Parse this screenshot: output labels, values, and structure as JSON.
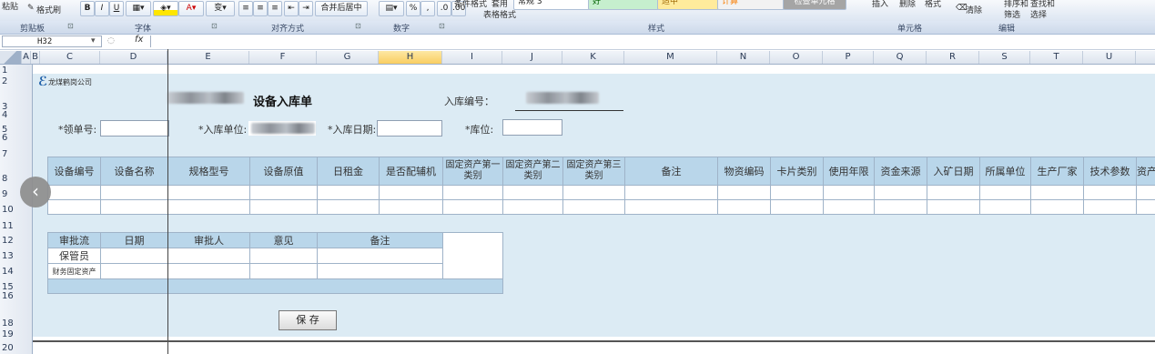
{
  "ribbon": {
    "paste": "粘贴",
    "format_painter": "格式刷",
    "bold": "B",
    "italic": "I",
    "underline": "U",
    "wrap_merge": "合并后居中",
    "percent": "%",
    "comma": ",",
    "cond_format": "条件格式",
    "table_format_1": "套用",
    "table_format_2": "表格格式",
    "style_normal": "常规 3",
    "style_good": "好",
    "style_neutral": "适中",
    "style_calc": "计算",
    "style_check": "检查单元格",
    "insert": "插入",
    "delete": "删除",
    "format": "格式",
    "clear": "清除",
    "sort_filter_1": "排序和",
    "sort_filter_2": "筛选",
    "find_select_1": "查找和",
    "find_select_2": "选择"
  },
  "groups": {
    "clipboard": "剪贴板",
    "font": "字体",
    "alignment": "对齐方式",
    "number": "数字",
    "styles": "样式",
    "cells": "单元格",
    "editing": "编辑"
  },
  "formula_bar": {
    "name_box": "H32",
    "fx": "fx",
    "value": ""
  },
  "columns": [
    "A",
    "B",
    "C",
    "D",
    "E",
    "F",
    "G",
    "H",
    "I",
    "J",
    "K",
    "M",
    "N",
    "O",
    "P",
    "Q",
    "R",
    "S",
    "T",
    "U"
  ],
  "selected_column": "H",
  "rows": [
    "1",
    "2",
    "3",
    "4",
    "5",
    "6",
    "7",
    "8",
    "9",
    "10",
    "11",
    "12",
    "13",
    "14",
    "15",
    "16",
    "18",
    "19",
    "20"
  ],
  "form": {
    "company": "龙煤鹤岗公司",
    "title": "设备入库单",
    "entry_no_label": "入库编号：",
    "requisition_label": "*领单号:",
    "unit_label": "*入库单位:",
    "date_label": "*入库日期:",
    "location_label": "*库位:",
    "table_headers": [
      "设备编号",
      "设备名称",
      "规格型号",
      "设备原值",
      "日租金",
      "是否配辅机",
      "固定资产第一类别",
      "固定资产第二类别",
      "固定资产第三类别",
      "备注",
      "物资编码",
      "卡片类别",
      "使用年限",
      "资金来源",
      "入矿日期",
      "所属单位",
      "生产厂家",
      "技术参数",
      "资产"
    ],
    "approval_headers": [
      "审批流",
      "日期",
      "审批人",
      "意见",
      "备注"
    ],
    "approval_rows": [
      "保管员",
      "财务固定资产"
    ],
    "save_button": "保 存"
  },
  "colors": {
    "form_bg": "#dcebf4",
    "header_bg": "#b9d6ea",
    "selected_col": "#f9cd61"
  }
}
